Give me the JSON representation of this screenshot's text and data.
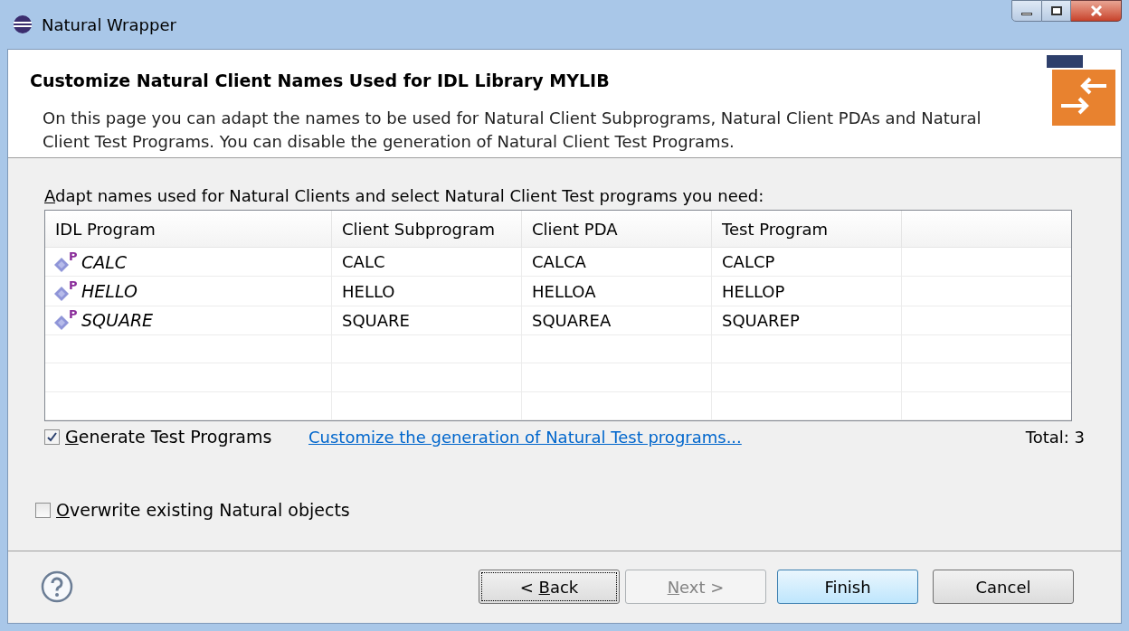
{
  "window": {
    "title": "Natural Wrapper"
  },
  "header": {
    "title": "Customize Natural Client Names Used for IDL Library MYLIB",
    "description": "On this page you can adapt the names to be used for Natural Client Subprograms, Natural Client PDAs and Natural Client Test Programs. You can disable the generation of Natural Client Test Programs."
  },
  "table_label": {
    "key": "A",
    "after": "dapt names used for Natural Clients and select Natural Client Test programs you need:"
  },
  "table": {
    "columns": [
      "IDL Program",
      "Client Subprogram",
      "Client PDA",
      "Test Program"
    ],
    "rows": [
      {
        "badge": "P",
        "cells": [
          "CALC",
          "CALC",
          "CALCA",
          "CALCP"
        ]
      },
      {
        "badge": "P",
        "cells": [
          "HELLO",
          "HELLO",
          "HELLOA",
          "HELLOP"
        ]
      },
      {
        "badge": "P",
        "cells": [
          "SQUARE",
          "SQUARE",
          "SQUAREA",
          "SQUAREP"
        ]
      }
    ]
  },
  "generate_checkbox": {
    "key": "G",
    "after": "enerate Test Programs",
    "checked": true
  },
  "customize_link": "Customize the generation of Natural Test programs...",
  "total": "Total: 3",
  "overwrite_checkbox": {
    "key": "O",
    "after": "verwrite existing Natural objects",
    "checked": false
  },
  "buttons": [
    {
      "before": "< ",
      "key": "B",
      "after": "ack",
      "disabled": false,
      "kind": "focused"
    },
    {
      "key": "N",
      "after": "ext >",
      "disabled": true,
      "kind": "normal"
    },
    {
      "after": "Finish",
      "disabled": false,
      "kind": "default"
    },
    {
      "after": "Cancel",
      "disabled": false,
      "kind": "normal"
    }
  ]
}
